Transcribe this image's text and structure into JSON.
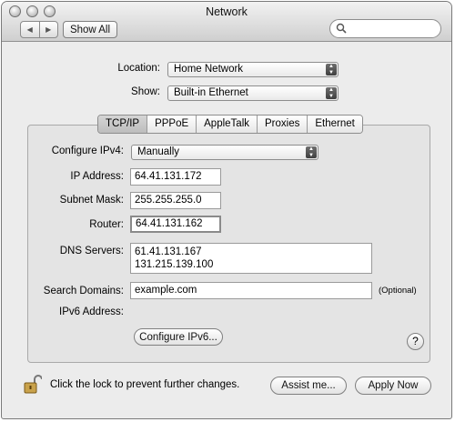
{
  "window": {
    "title": "Network"
  },
  "toolbar": {
    "back_glyph": "◀",
    "forward_glyph": "▶",
    "show_all_label": "Show All",
    "search_value": ""
  },
  "location": {
    "label": "Location:",
    "value": "Home Network"
  },
  "show": {
    "label": "Show:",
    "value": "Built-in Ethernet"
  },
  "tabs": [
    {
      "label": "TCP/IP",
      "active": true
    },
    {
      "label": "PPPoE",
      "active": false
    },
    {
      "label": "AppleTalk",
      "active": false
    },
    {
      "label": "Proxies",
      "active": false
    },
    {
      "label": "Ethernet",
      "active": false
    }
  ],
  "form": {
    "configure_ipv4_label": "Configure IPv4:",
    "configure_ipv4_value": "Manually",
    "ip_address_label": "IP Address:",
    "ip_address_value": "64.41.131.172",
    "subnet_mask_label": "Subnet Mask:",
    "subnet_mask_value": "255.255.255.0",
    "router_label": "Router:",
    "router_value": "64.41.131.162",
    "dns_servers_label": "DNS Servers:",
    "dns_servers": [
      "61.41.131.167",
      "131.215.139.100"
    ],
    "search_domains_label": "Search Domains:",
    "search_domains_value": "example.com",
    "search_domains_hint": "(Optional)",
    "ipv6_address_label": "IPv6 Address:",
    "configure_ipv6_label": "Configure IPv6...",
    "help_glyph": "?"
  },
  "footer": {
    "lock_text": "Click the lock to prevent further changes.",
    "assist_label": "Assist me...",
    "apply_label": "Apply Now"
  },
  "colors": {
    "window_bg": "#ececec",
    "pane_bg": "#e4e4e4",
    "active_tab": "#c4c4c4"
  },
  "icons": [
    "close-icon",
    "minimize-icon",
    "zoom-icon",
    "back-arrow-icon",
    "forward-arrow-icon",
    "search-icon",
    "popup-arrows-icon",
    "help-icon",
    "lock-icon"
  ]
}
